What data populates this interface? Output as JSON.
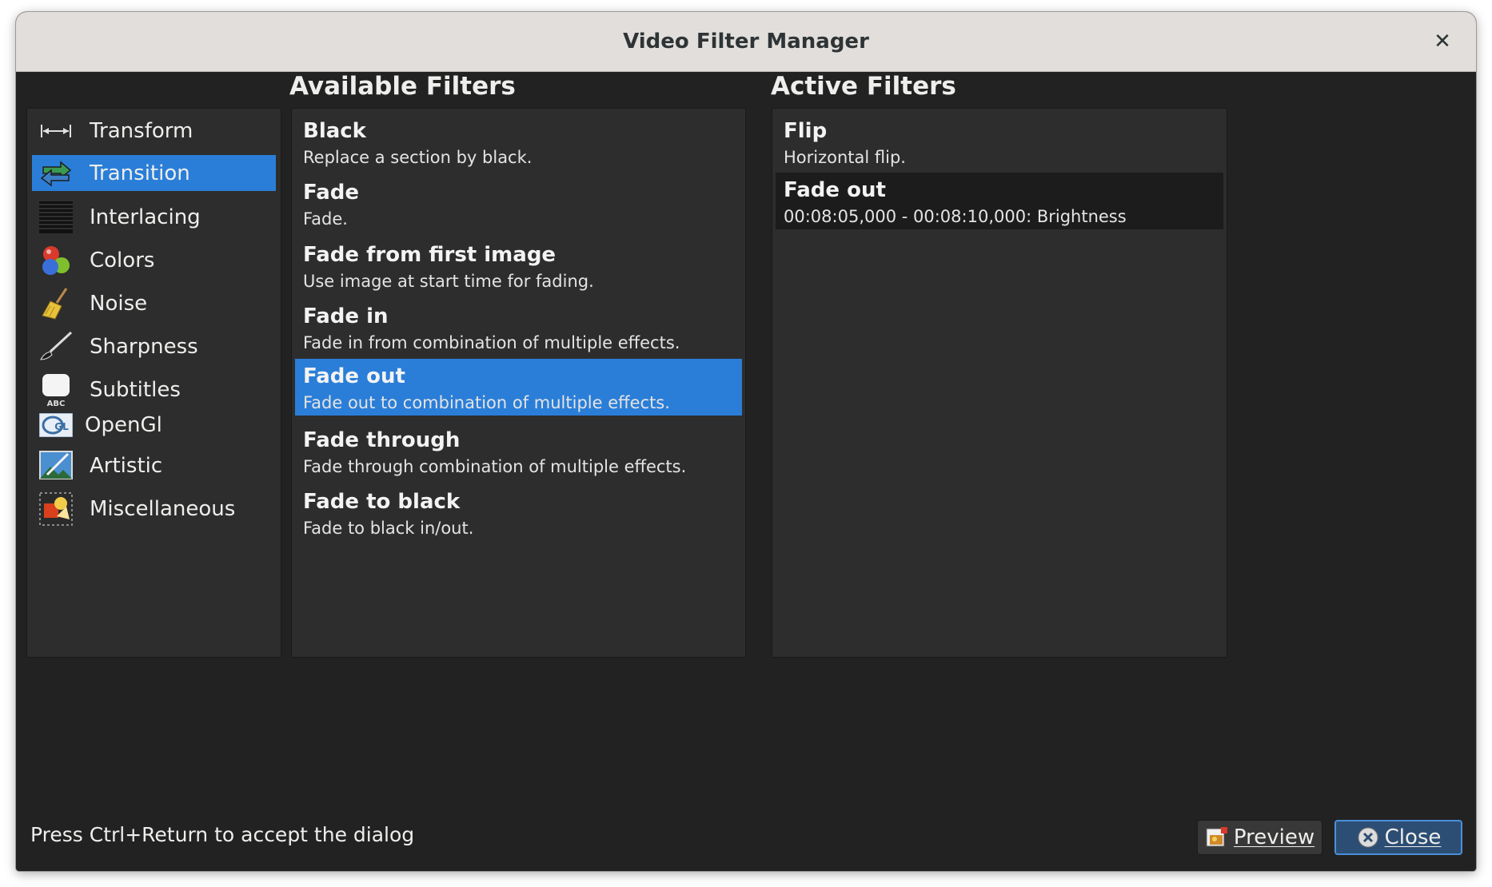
{
  "window": {
    "title": "Video Filter Manager",
    "close_glyph": "✕"
  },
  "headings": {
    "available": "Available Filters",
    "active": "Active Filters"
  },
  "categories": [
    {
      "label": "Transform",
      "icon": "transform-icon"
    },
    {
      "label": "Transition",
      "icon": "transition-icon",
      "selected": true
    },
    {
      "label": "Interlacing",
      "icon": "interlacing-icon"
    },
    {
      "label": "Colors",
      "icon": "colors-icon"
    },
    {
      "label": "Noise",
      "icon": "noise-broom-icon"
    },
    {
      "label": "Sharpness",
      "icon": "sharpness-brush-icon"
    },
    {
      "label": "Subtitles",
      "icon": "subtitles-icon"
    },
    {
      "label": "OpenGl",
      "icon": "opengl-icon"
    },
    {
      "label": "Artistic",
      "icon": "artistic-icon"
    },
    {
      "label": "Miscellaneous",
      "icon": "miscellaneous-icon"
    }
  ],
  "available_filters": [
    {
      "name": "Black",
      "desc": "Replace a section by black."
    },
    {
      "name": "Fade",
      "desc": "Fade."
    },
    {
      "name": "Fade from first image",
      "desc": "Use image at start time for fading."
    },
    {
      "name": "Fade in",
      "desc": "Fade in from combination of multiple effects."
    },
    {
      "name": "Fade out",
      "desc": "Fade out to combination of multiple effects.",
      "selected": true
    },
    {
      "name": "Fade through",
      "desc": "Fade through combination of multiple effects."
    },
    {
      "name": "Fade to black",
      "desc": "Fade to black in/out."
    }
  ],
  "active_filters": [
    {
      "name": "Flip",
      "desc": "Horizontal flip."
    },
    {
      "name": "Fade out",
      "desc": "00:08:05,000 - 00:08:10,000: Brightness",
      "highlighted": true
    }
  ],
  "footer": {
    "hint": "Press Ctrl+Return to accept the dialog",
    "preview_label": "Preview",
    "close_label": "Close"
  },
  "colors": {
    "selection": "#2a7ed8",
    "background": "#222222",
    "panel": "#2d2d2d"
  }
}
